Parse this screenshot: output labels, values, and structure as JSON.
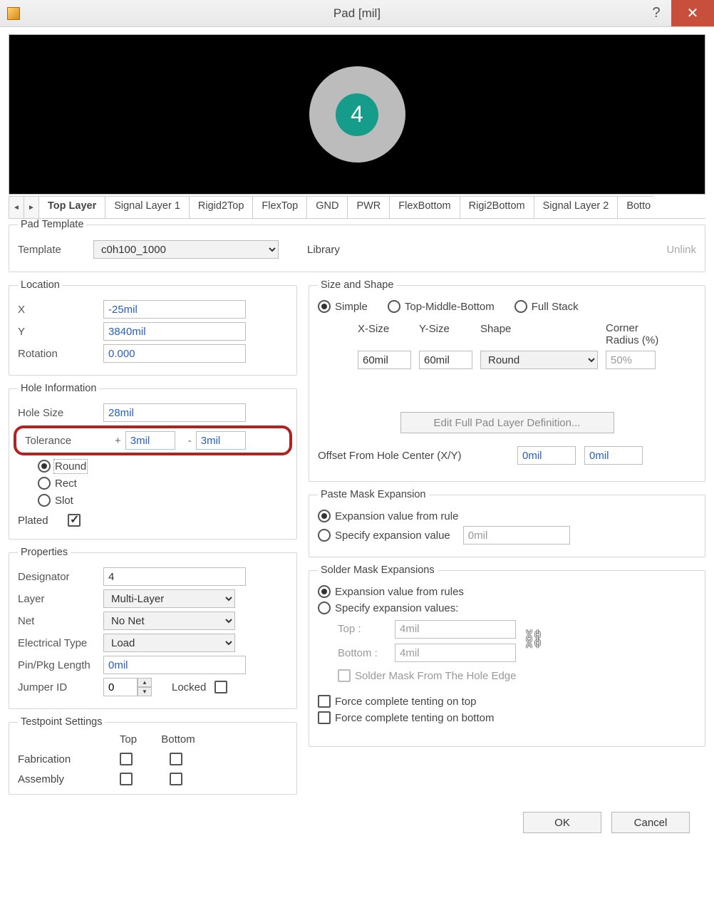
{
  "title": "Pad [mil]",
  "preview": {
    "designator": "4"
  },
  "tabs": [
    "Top Layer",
    "Signal Layer 1",
    "Rigid2Top",
    "FlexTop",
    "GND",
    "PWR",
    "FlexBottom",
    "Rigi2Bottom",
    "Signal Layer 2",
    "Botto"
  ],
  "active_tab": 0,
  "pad_template": {
    "legend": "Pad Template",
    "template_label": "Template",
    "template_value": "c0h100_1000",
    "library_label": "Library",
    "unlink_label": "Unlink"
  },
  "location": {
    "legend": "Location",
    "x_label": "X",
    "x_value": "-25mil",
    "y_label": "Y",
    "y_value": "3840mil",
    "rot_label": "Rotation",
    "rot_value": "0.000"
  },
  "hole": {
    "legend": "Hole Information",
    "size_label": "Hole Size",
    "size_value": "28mil",
    "tol_label": "Tolerance",
    "tol_plus": "3mil",
    "tol_minus": "3mil",
    "shape_round": "Round",
    "shape_rect": "Rect",
    "shape_slot": "Slot",
    "plated_label": "Plated"
  },
  "props": {
    "legend": "Properties",
    "designator_label": "Designator",
    "designator_value": "4",
    "layer_label": "Layer",
    "layer_value": "Multi-Layer",
    "net_label": "Net",
    "net_value": "No Net",
    "etype_label": "Electrical Type",
    "etype_value": "Load",
    "pinlen_label": "Pin/Pkg Length",
    "pinlen_value": "0mil",
    "jumper_label": "Jumper ID",
    "jumper_value": "0",
    "locked_label": "Locked"
  },
  "testpoint": {
    "legend": "Testpoint Settings",
    "top_hdr": "Top",
    "bot_hdr": "Bottom",
    "fab_label": "Fabrication",
    "asm_label": "Assembly"
  },
  "size_shape": {
    "legend": "Size and Shape",
    "simple": "Simple",
    "tmb": "Top-Middle-Bottom",
    "full": "Full Stack",
    "xsize_h": "X-Size",
    "ysize_h": "Y-Size",
    "shape_h": "Shape",
    "corner_h": "Corner Radius (%)",
    "xsize_v": "60mil",
    "ysize_v": "60mil",
    "shape_v": "Round",
    "corner_v": "50%",
    "edit_btn": "Edit Full Pad Layer Definition...",
    "offset_label": "Offset From Hole Center (X/Y)",
    "offx": "0mil",
    "offy": "0mil"
  },
  "paste": {
    "legend": "Paste Mask Expansion",
    "rule": "Expansion value from rule",
    "spec": "Specify expansion value",
    "val": "0mil"
  },
  "solder": {
    "legend": "Solder Mask Expansions",
    "rules": "Expansion value from rules",
    "spec": "Specify expansion values:",
    "top_l": "Top :",
    "top_v": "4mil",
    "bot_l": "Bottom :",
    "bot_v": "4mil",
    "hole_edge": "Solder Mask From The Hole Edge",
    "tent_top": "Force complete tenting on top",
    "tent_bot": "Force complete tenting on bottom"
  },
  "footer": {
    "ok": "OK",
    "cancel": "Cancel"
  }
}
